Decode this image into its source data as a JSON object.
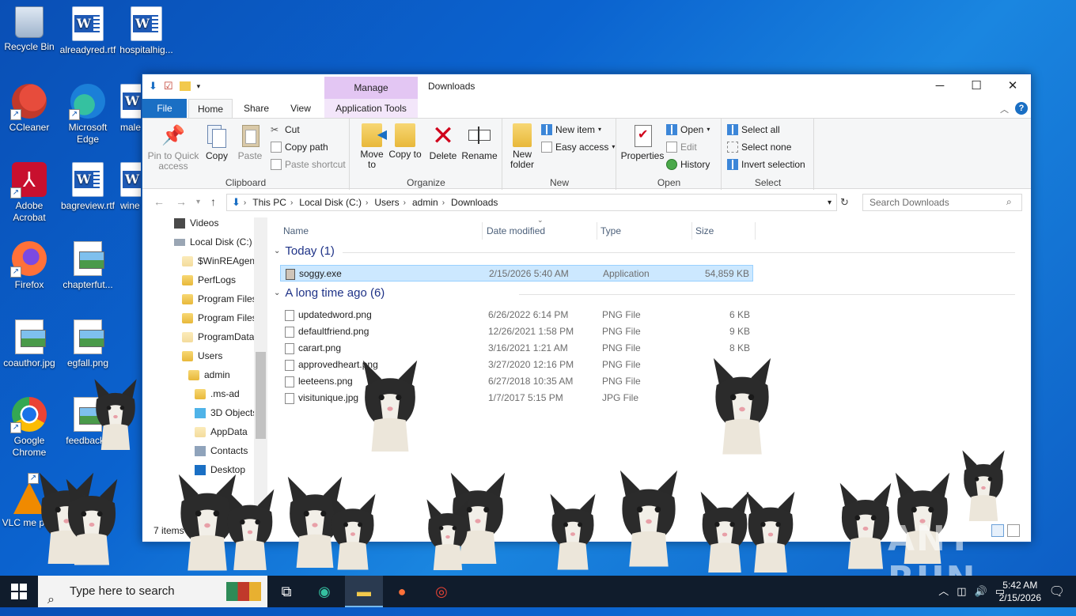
{
  "desktop": {
    "icons": [
      {
        "label": "Recycle Bin"
      },
      {
        "label": "alreadyred.rtf"
      },
      {
        "label": "hospitalhig..."
      },
      {
        "label": "CCleaner"
      },
      {
        "label": "Microsoft Edge"
      },
      {
        "label": "male"
      },
      {
        "label": "Adobe Acrobat"
      },
      {
        "label": "bagreview.rtf"
      },
      {
        "label": "wine"
      },
      {
        "label": "Firefox"
      },
      {
        "label": "chapterfut..."
      },
      {
        "label": "coauthor.jpg"
      },
      {
        "label": "egfall.png"
      },
      {
        "label": "Google Chrome"
      },
      {
        "label": "feedbackh"
      },
      {
        "label": "VLC me play"
      }
    ]
  },
  "window": {
    "title": "Downloads",
    "manage_tab": "Manage",
    "controls": {
      "minimize": "─",
      "maximize": "☐",
      "close": "✕"
    },
    "tabs": {
      "file": "File",
      "home": "Home",
      "share": "Share",
      "view": "View",
      "app_tools": "Application Tools"
    },
    "ribbon": {
      "clipboard": {
        "label": "Clipboard",
        "pin": "Pin to Quick access",
        "copy": "Copy",
        "paste": "Paste",
        "cut": "Cut",
        "copy_path": "Copy path",
        "paste_shortcut": "Paste shortcut"
      },
      "organize": {
        "label": "Organize",
        "move_to": "Move to",
        "copy_to": "Copy to",
        "delete": "Delete",
        "rename": "Rename"
      },
      "new": {
        "label": "New",
        "new_folder": "New folder",
        "new_item": "New item",
        "easy_access": "Easy access"
      },
      "open": {
        "label": "Open",
        "properties": "Properties",
        "open": "Open",
        "edit": "Edit",
        "history": "History"
      },
      "select": {
        "label": "Select",
        "select_all": "Select all",
        "select_none": "Select none",
        "invert": "Invert selection"
      }
    },
    "address": {
      "crumbs": [
        "This PC",
        "Local Disk (C:)",
        "Users",
        "admin",
        "Downloads"
      ],
      "search_placeholder": "Search Downloads"
    },
    "nav": [
      {
        "label": "Videos"
      },
      {
        "label": "Local Disk (C:)"
      },
      {
        "label": "$WinREAgent"
      },
      {
        "label": "PerfLogs"
      },
      {
        "label": "Program Files"
      },
      {
        "label": "Program Files"
      },
      {
        "label": "ProgramData"
      },
      {
        "label": "Users"
      },
      {
        "label": "admin"
      },
      {
        "label": ".ms-ad"
      },
      {
        "label": "3D Objects"
      },
      {
        "label": "AppData"
      },
      {
        "label": "Contacts"
      },
      {
        "label": "Desktop"
      }
    ],
    "columns": {
      "name": "Name",
      "date": "Date modified",
      "type": "Type",
      "size": "Size"
    },
    "groups": {
      "today": "Today (1)",
      "long_ago": "A long time ago (6)"
    },
    "files_today": [
      {
        "name": "soggy.exe",
        "date": "2/15/2026 5:40 AM",
        "type": "Application",
        "size": "54,859 KB"
      }
    ],
    "files_old": [
      {
        "name": "updatedword.png",
        "date": "6/26/2022 6:14 PM",
        "type": "PNG File",
        "size": "6 KB"
      },
      {
        "name": "defaultfriend.png",
        "date": "12/26/2021 1:58 PM",
        "type": "PNG File",
        "size": "9 KB"
      },
      {
        "name": "carart.png",
        "date": "3/16/2021 1:21 AM",
        "type": "PNG File",
        "size": "8 KB"
      },
      {
        "name": "approvedheart.png",
        "date": "3/27/2020 12:16 PM",
        "type": "PNG File",
        "size": ""
      },
      {
        "name": "leeteens.png",
        "date": "6/27/2018 10:35 AM",
        "type": "PNG File",
        "size": ""
      },
      {
        "name": "visitunique.jpg",
        "date": "1/7/2017 5:15 PM",
        "type": "JPG File",
        "size": ""
      }
    ],
    "status": "7 items"
  },
  "taskbar": {
    "search_placeholder": "Type here to search",
    "time": "5:42 AM",
    "date": "2/15/2026"
  },
  "watermark": "ANY RUN",
  "colors": {
    "accent": "#1a6fc4",
    "selection": "#cce8ff",
    "manage_tab": "#e3c6f3"
  }
}
